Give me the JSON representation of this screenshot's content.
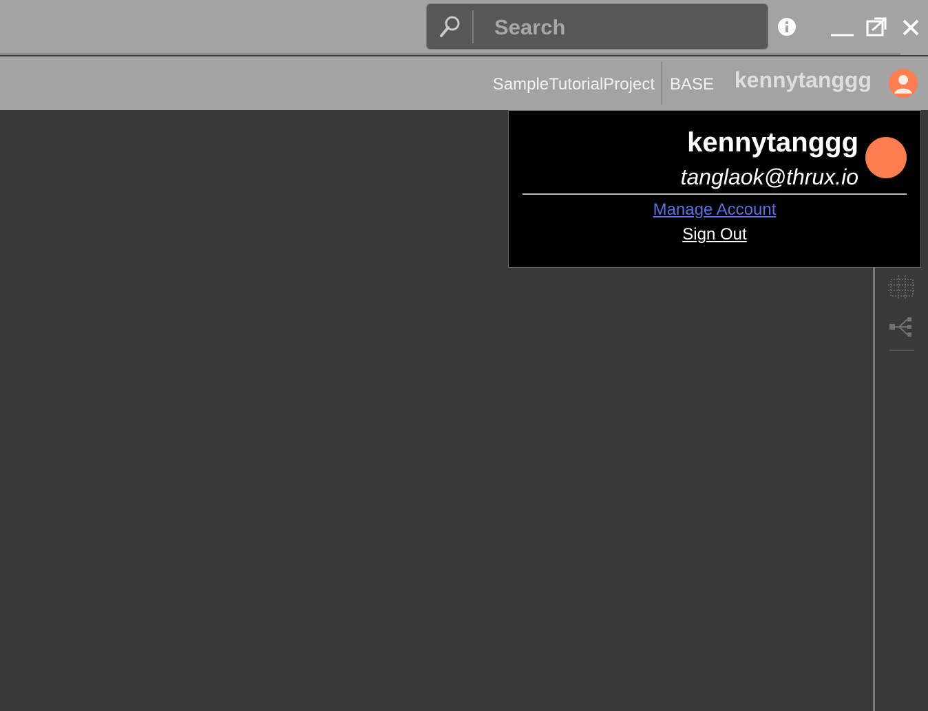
{
  "search": {
    "placeholder": "Search"
  },
  "icons": {
    "search": "search-icon",
    "info": "info-icon",
    "minimize": "minimize-icon",
    "restore": "restore-window-icon",
    "close": "close-icon",
    "user": "user-avatar-icon",
    "grid": "grid-icon",
    "tree": "hierarchy-icon"
  },
  "toolbar": {
    "project": "SampleTutorialProject",
    "branch": "BASE",
    "username": "kennytanggg"
  },
  "account_popup": {
    "username": "kennytanggg",
    "email": "tanglaok@thrux.io",
    "manage_account_label": "Manage Account",
    "sign_out_label": "Sign Out"
  },
  "colors": {
    "avatar": "#ff7d4e",
    "link": "#5c6ee0",
    "chrome": "#a3a3a3",
    "canvas": "#393939"
  }
}
